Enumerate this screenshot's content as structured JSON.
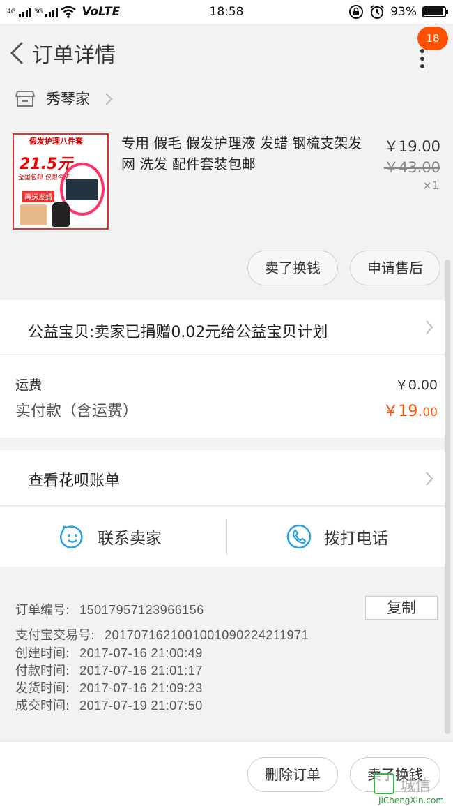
{
  "status_bar": {
    "network_4g": "4G",
    "network_3g": "3G",
    "volte": "VoLTE",
    "time": "18:58",
    "battery_percent": "93%",
    "battery_level": 0.93
  },
  "header": {
    "title": "订单详情",
    "badge_count": "18"
  },
  "shop": {
    "name": "秀琴家"
  },
  "product": {
    "thumbnail": {
      "top_text": "假发护理八件套",
      "price_text": "21.5元",
      "sub_text": "全国包邮 仅限今天",
      "tag_text": "再送发蜡"
    },
    "title": "专用 假毛 假发护理液 发蜡 钢梳支架发网 洗发 配件套装包邮",
    "price": "￥19.00",
    "original_price": "￥43.00",
    "quantity": "×1",
    "actions": {
      "sell_label": "卖了换钱",
      "after_sale_label": "申请售后"
    }
  },
  "charity": {
    "text": "公益宝贝:卖家已捐赠0.02元给公益宝贝计划"
  },
  "payment": {
    "shipping_label": "运费",
    "shipping_value": "￥0.00",
    "paid_label": "实付款（含运费）",
    "paid_value_main": "￥19.",
    "paid_value_decimal": "00"
  },
  "huabei": {
    "label": "查看花呗账单"
  },
  "contact": {
    "seller_label": "联系卖家",
    "call_label": "拨打电话"
  },
  "order_info": {
    "order_no_label": "订单编号:",
    "order_no": "15017957123966156",
    "copy_label": "复制",
    "alipay_label": "支付宝交易号:",
    "alipay_no": "2017071621001001090224211971",
    "created_label": "创建时间:",
    "created": "2017-07-16 21:00:49",
    "paid_label": "付款时间:",
    "paid": "2017-07-16 21:01:17",
    "shipped_label": "发货时间:",
    "shipped": "2017-07-16 21:09:23",
    "closed_label": "成交时间:",
    "closed": "2017-07-19 21:07:50"
  },
  "bottom_bar": {
    "delete_label": "删除订单",
    "sell_label": "卖了换钱"
  },
  "watermark": {
    "text": "城信",
    "url": "JiChengXin.com"
  },
  "colors": {
    "accent": "#ff5000",
    "icon_blue": "#29a3e6",
    "background": "#f2f2f2"
  }
}
